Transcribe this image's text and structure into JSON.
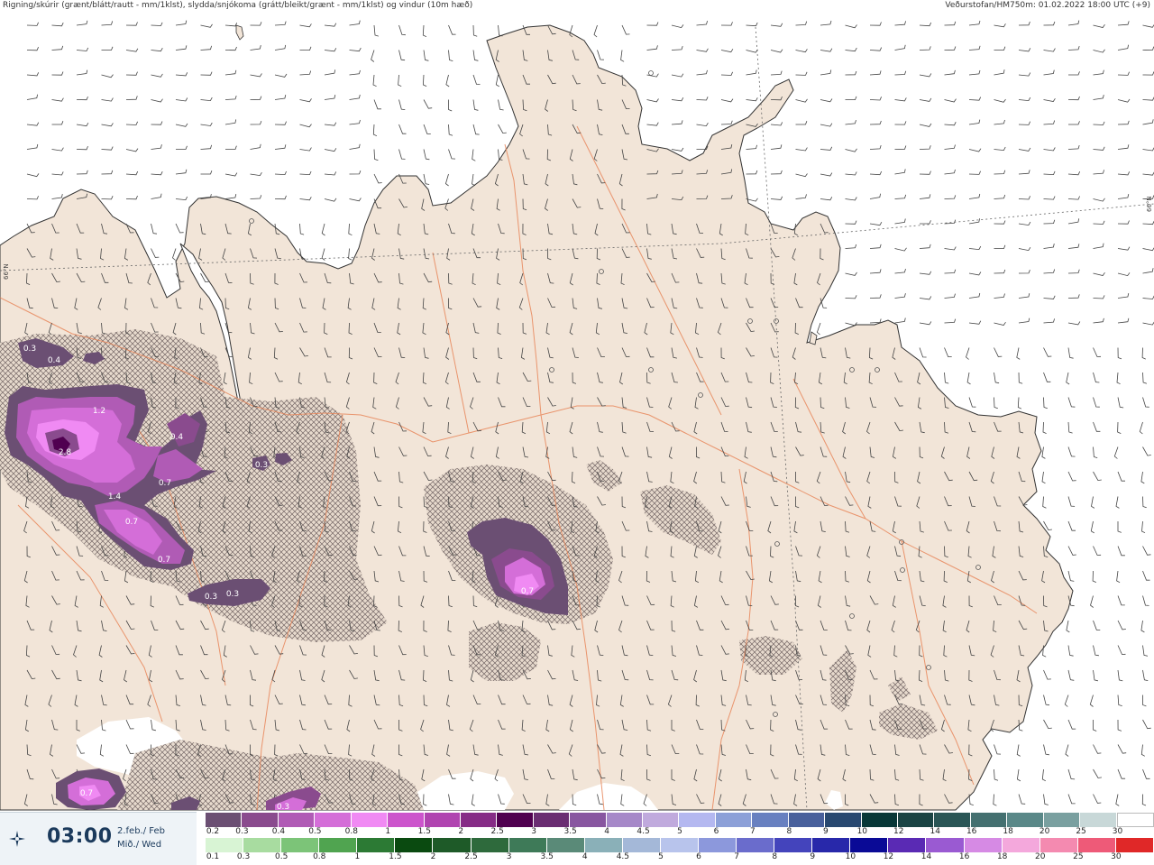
{
  "header": {
    "left": "Rigning/skúrir (grænt/blátt/rautt - mm/1klst), slydda/snjókoma (grátt/bleikt/grænt - mm/1klst) og vindur (10m hæð)",
    "right": "Veðurstofan/HM750m: 01.02.2022 18:00 UTC (+9)"
  },
  "latitude_labels": {
    "left": "66°N",
    "right": "66°N"
  },
  "time_panel": {
    "time": "03:00",
    "date_line1": "2.feb./ Feb",
    "date_line2": "Mið./ Wed",
    "icon": "compass-rose-icon"
  },
  "precip_labels": [
    {
      "text": "0.3"
    },
    {
      "text": "0.4"
    },
    {
      "text": "1.2"
    },
    {
      "text": "2.8"
    },
    {
      "text": "0.4"
    },
    {
      "text": "0.3"
    },
    {
      "text": "0.7"
    },
    {
      "text": "1.4"
    },
    {
      "text": "0.7"
    },
    {
      "text": "0.7"
    },
    {
      "text": "0.3"
    },
    {
      "text": "0.3"
    },
    {
      "text": "0.7"
    },
    {
      "text": "0.7"
    },
    {
      "text": "0.3"
    }
  ],
  "legend": {
    "snow_scale": {
      "labels": [
        "0.2",
        "0.3",
        "0.4",
        "0.5",
        "0.8",
        "1",
        "1.5",
        "2",
        "2.5",
        "3",
        "3.5",
        "4",
        "4.5",
        "5",
        "6",
        "7",
        "8",
        "9",
        "10",
        "12",
        "14",
        "16",
        "18",
        "20",
        "25",
        "30"
      ],
      "colors": [
        "#6b4f73",
        "#8a4b8e",
        "#b05bb5",
        "#d46ed8",
        "#f08af3",
        "#cc55cc",
        "#b044b0",
        "#862c86",
        "#500050",
        "#6a2d72",
        "#8856a0",
        "#a688c8",
        "#c0aadd",
        "#b4b8f0",
        "#8ca0d8",
        "#6880c0",
        "#48609c",
        "#284870",
        "#083838",
        "#1a4444",
        "#2a5656",
        "#447070",
        "#5a8888",
        "#7aa0a0",
        "#c8d8d8",
        "#ffffff"
      ]
    },
    "rain_scale": {
      "labels": [
        "0.1",
        "0.3",
        "0.5",
        "0.8",
        "1",
        "1.5",
        "2",
        "2.5",
        "3",
        "3.5",
        "4",
        "4.5",
        "5",
        "6",
        "7",
        "8",
        "9",
        "10",
        "12",
        "14",
        "16",
        "18",
        "20",
        "25",
        "30"
      ],
      "colors": [
        "#d8f4d4",
        "#a8dca0",
        "#7cc478",
        "#50a450",
        "#2c7a34",
        "#0a4a10",
        "#1e5a28",
        "#2e6a3c",
        "#3e7a58",
        "#5a8a78",
        "#8ab0b8",
        "#a4b8d8",
        "#b8c4ec",
        "#8c98dc",
        "#6a6ccc",
        "#4444bc",
        "#2828aa",
        "#0a0a96",
        "#5a2ab4",
        "#9a5ad2",
        "#d68ae4",
        "#f4a8dc",
        "#f48ab0",
        "#ee5a78",
        "#e02828"
      ]
    }
  }
}
